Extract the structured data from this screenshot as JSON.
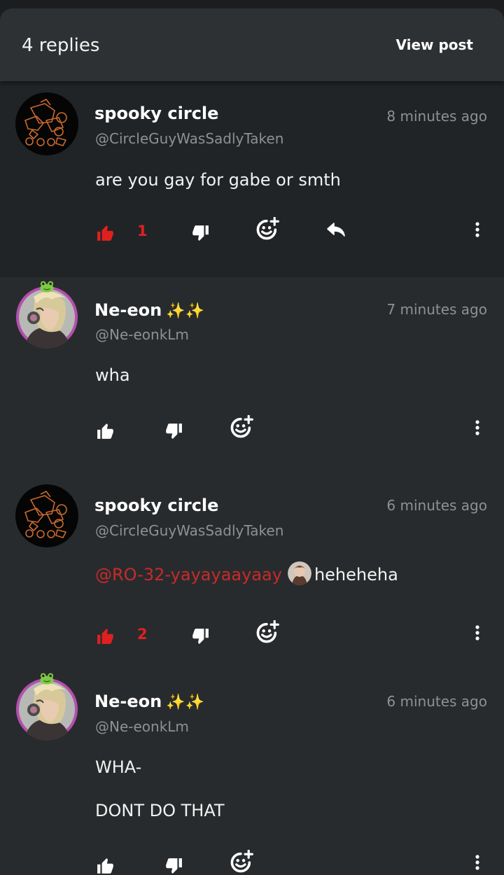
{
  "header": {
    "replies_count": "4 replies",
    "view_post_label": "View post"
  },
  "colors": {
    "liked": "#e02020",
    "mention": "#c82a2a",
    "sparkles": "#f3d24a"
  },
  "comments": [
    {
      "author": "spooky circle",
      "handle": "@CircleGuyWasSadlyTaken",
      "time": "8 minutes ago",
      "body": "are you gay for gabe or smth",
      "likes": "1",
      "liked": true,
      "has_reply_icon": true,
      "avatar": "shapes-doodle-avatar"
    },
    {
      "author": "Ne-eon",
      "author_decoration": "✨✨",
      "handle": "@Ne-eonkLm",
      "time": "7 minutes ago",
      "body": "wha",
      "avatar": "anime-headphones-avatar"
    },
    {
      "author": "spooky circle",
      "handle": "@CircleGuyWasSadlyTaken",
      "time": "6 minutes ago",
      "mention": "@RO-32-yayayaayaay",
      "body_after_mention": "heheheha",
      "likes": "2",
      "liked": true,
      "avatar": "shapes-doodle-avatar"
    },
    {
      "author": "Ne-eon",
      "author_decoration": "✨✨",
      "handle": "@Ne-eonkLm",
      "time": "6 minutes ago",
      "body_line1": "WHA-",
      "body_line2": "DONT DO THAT",
      "avatar": "anime-headphones-avatar"
    }
  ]
}
